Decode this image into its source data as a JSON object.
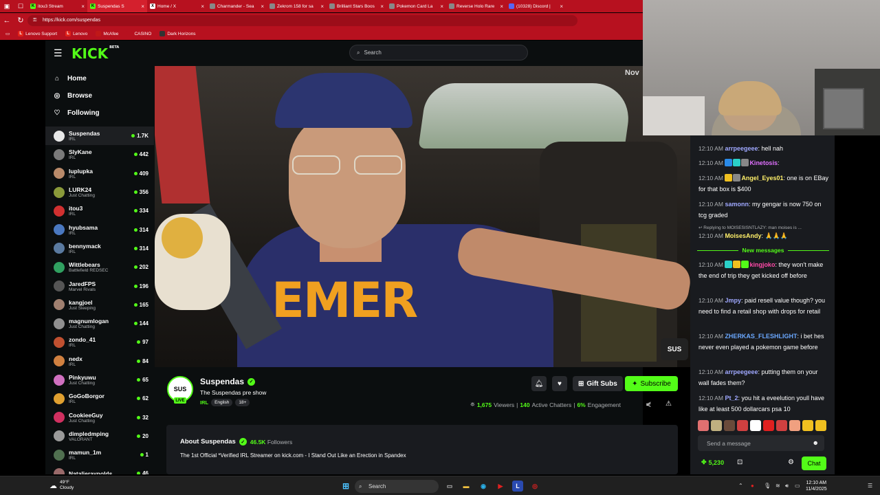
{
  "browser": {
    "tabs": [
      {
        "label": "itou3 Stream",
        "color": "#53fc18",
        "letter": "K"
      },
      {
        "label": "Suspendas S",
        "color": "#53fc18",
        "letter": "K",
        "active": true
      },
      {
        "label": "Home / X",
        "color": "#ffffff",
        "letter": "X"
      },
      {
        "label": "Charmander - Sea",
        "color": "#888888",
        "letter": ""
      },
      {
        "label": "Zekrom 158 for sa",
        "color": "#888888",
        "letter": ""
      },
      {
        "label": "Brilliant Stars Boos",
        "color": "#888888",
        "letter": ""
      },
      {
        "label": "Pokemon Card La",
        "color": "#888888",
        "letter": ""
      },
      {
        "label": "Reverse Holo Rare",
        "color": "#888888",
        "letter": ""
      },
      {
        "label": "(10328) Discord |",
        "color": "#5865f2",
        "letter": ""
      }
    ],
    "url": "https://kick.com/suspendas",
    "bookmarks": [
      {
        "label": "Lenovo Support",
        "letter": "L",
        "color": "#e2231a"
      },
      {
        "label": "Lenovo",
        "letter": "L",
        "color": "#e2231a"
      },
      {
        "label": "McAfee",
        "letter": "",
        "color": "#c01818"
      },
      {
        "label": "CASINO",
        "letter": "",
        "color": "#b7111f"
      },
      {
        "label": "Dark Horizons",
        "letter": "",
        "color": "#333333"
      }
    ]
  },
  "kick": {
    "logo": "KICK",
    "logo_sup": "BETA",
    "search_placeholder": "Search",
    "nav": [
      {
        "label": "Home",
        "icon": "home-icon",
        "glyph": "⌂"
      },
      {
        "label": "Browse",
        "icon": "compass-icon",
        "glyph": "◎"
      },
      {
        "label": "Following",
        "icon": "heart-icon",
        "glyph": "♡"
      }
    ],
    "following": [
      {
        "name": "Suspendas",
        "category": "IRL",
        "viewers": "1.7K",
        "color": "#e8e8e8",
        "selected": true
      },
      {
        "name": "SlyKane",
        "category": "IRL",
        "viewers": "442",
        "color": "#7a7a7a"
      },
      {
        "name": "luplupka",
        "category": "IRL",
        "viewers": "409",
        "color": "#b98a6a"
      },
      {
        "name": "LURK24",
        "category": "Just Chatting",
        "viewers": "356",
        "color": "#8a9a3a"
      },
      {
        "name": "itou3",
        "category": "IRL",
        "viewers": "334",
        "color": "#d03030"
      },
      {
        "name": "hyubsama",
        "category": "IRL",
        "viewers": "314",
        "color": "#4a78c0"
      },
      {
        "name": "bennymack",
        "category": "IRL",
        "viewers": "314",
        "color": "#5a7aa0"
      },
      {
        "name": "Wittlebears",
        "category": "Battlefield REDSEC",
        "viewers": "202",
        "color": "#30a060"
      },
      {
        "name": "JaredFPS",
        "category": "Marvel Rivals",
        "viewers": "196",
        "color": "#555555"
      },
      {
        "name": "kangjoel",
        "category": "Just Sleeping",
        "viewers": "165",
        "color": "#a08070"
      },
      {
        "name": "magnumlogan",
        "category": "Just Chatting",
        "viewers": "144",
        "color": "#909090"
      },
      {
        "name": "zondo_41",
        "category": "IRL",
        "viewers": "97",
        "color": "#c05030"
      },
      {
        "name": "nedx",
        "category": "IRL",
        "viewers": "84",
        "color": "#d08040"
      },
      {
        "name": "Pinkyuwu",
        "category": "Just Chatting",
        "viewers": "65",
        "color": "#d070c0"
      },
      {
        "name": "GoGoBorgor",
        "category": "IRL",
        "viewers": "62",
        "color": "#e0a030"
      },
      {
        "name": "CookieeGuy",
        "category": "Just Chatting",
        "viewers": "32",
        "color": "#d03060"
      },
      {
        "name": "dimpledmping",
        "category": "VALORANT",
        "viewers": "20",
        "color": "#9a9a9a"
      },
      {
        "name": "mamun_1m",
        "category": "IRL",
        "viewers": "1",
        "color": "#507050"
      },
      {
        "name": "Natalieraynolds",
        "category": "",
        "viewers": "46",
        "color": "#9a6a6a"
      }
    ],
    "video_overlay": "Nov",
    "watermark": "SUS",
    "stream": {
      "name": "Suspendas",
      "title": "The Suspendas pre show",
      "category": "IRL",
      "tags": [
        "English",
        "18+"
      ],
      "live_label": "LIVE",
      "avatar_text": "SUS",
      "gift_label": "Gift Subs",
      "subscribe_label": "Subscribe",
      "viewers": "1,675",
      "viewers_label": "Viewers",
      "chatters": "140",
      "chatters_label": "Active Chatters",
      "engagement": "6%",
      "engagement_label": "Engagement"
    },
    "about": {
      "title": "About Suspendas",
      "followers": "46.5K",
      "followers_label": "Followers",
      "description": "The 1st Official *Verified IRL Streamer on kick.com - I Stand Out Like an Erection in Spandex"
    },
    "chat": {
      "messages": [
        {
          "time": "12:10 AM",
          "user": "arrpeegeee",
          "color": "#9fa8ff",
          "text": "hell nah",
          "badges": []
        },
        {
          "time": "12:10 AM",
          "user": "Kinetosis",
          "color": "#e070ff",
          "text": "",
          "badges": [
            "#2a8ae8",
            "#2ad0c8",
            "#888888"
          ]
        },
        {
          "time": "12:10 AM",
          "user": "Angel_Eyes01",
          "color": "#fff06a",
          "text": "one is on EBay for that box is $400",
          "badges": [
            "#f0c020",
            "#888888"
          ]
        },
        {
          "time": "12:10 AM",
          "user": "samonn",
          "color": "#9fa8ff",
          "text": "my gengar is now 750 on tcg graded",
          "badges": []
        },
        {
          "time": "12:10 AM",
          "user": "MoisesAndy",
          "color": "#fff06a",
          "text": "🙏🙏🙏",
          "badges": []
        },
        {
          "time": "12:10 AM",
          "user": "kingjoko",
          "color": "#ff4aa8",
          "text": "they won't make the end of trip they get kicked off before",
          "badges": [
            "#2ad0c8",
            "#f0c020",
            "#53fc18"
          ]
        },
        {
          "time": "12:10 AM",
          "user": "Jmpy",
          "color": "#9fa8ff",
          "text": "paid resell value though? you need to find a retail shop with drops for retail",
          "badges": []
        },
        {
          "time": "12:10 AM",
          "user": "ZHERKAS_FLESHLIGHT",
          "color": "#6aa8ff",
          "text": "i bet hes never even played a pokemon game before",
          "badges": []
        },
        {
          "time": "12:10 AM",
          "user": "arrpeegeee",
          "color": "#9fa8ff",
          "text": "putting them on your wall fades them?",
          "badges": []
        },
        {
          "time": "12:10 AM",
          "user": "Pt_2",
          "color": "#9fa8ff",
          "text": "you hit a eveelution youll have like at least 500 dollarcars psa 10",
          "badges": []
        }
      ],
      "reply_text": "Replying to MOISESISNTLAZY: man moises is ...",
      "new_messages_label": "New messages",
      "input_placeholder": "Send a message",
      "points": "5,230",
      "chat_button": "Chat",
      "emote_colors": [
        "#e07070",
        "#c0b080",
        "#6a4a3a",
        "#d04040",
        "#ffffff",
        "#e02020",
        "#d04040",
        "#f0a080",
        "#f0c020",
        "#f0c020"
      ]
    }
  },
  "taskbar": {
    "weather_temp": "49°F",
    "weather_desc": "Cloudy",
    "search_placeholder": "Search",
    "time": "12:10 AM",
    "date": "11/4/2025"
  }
}
